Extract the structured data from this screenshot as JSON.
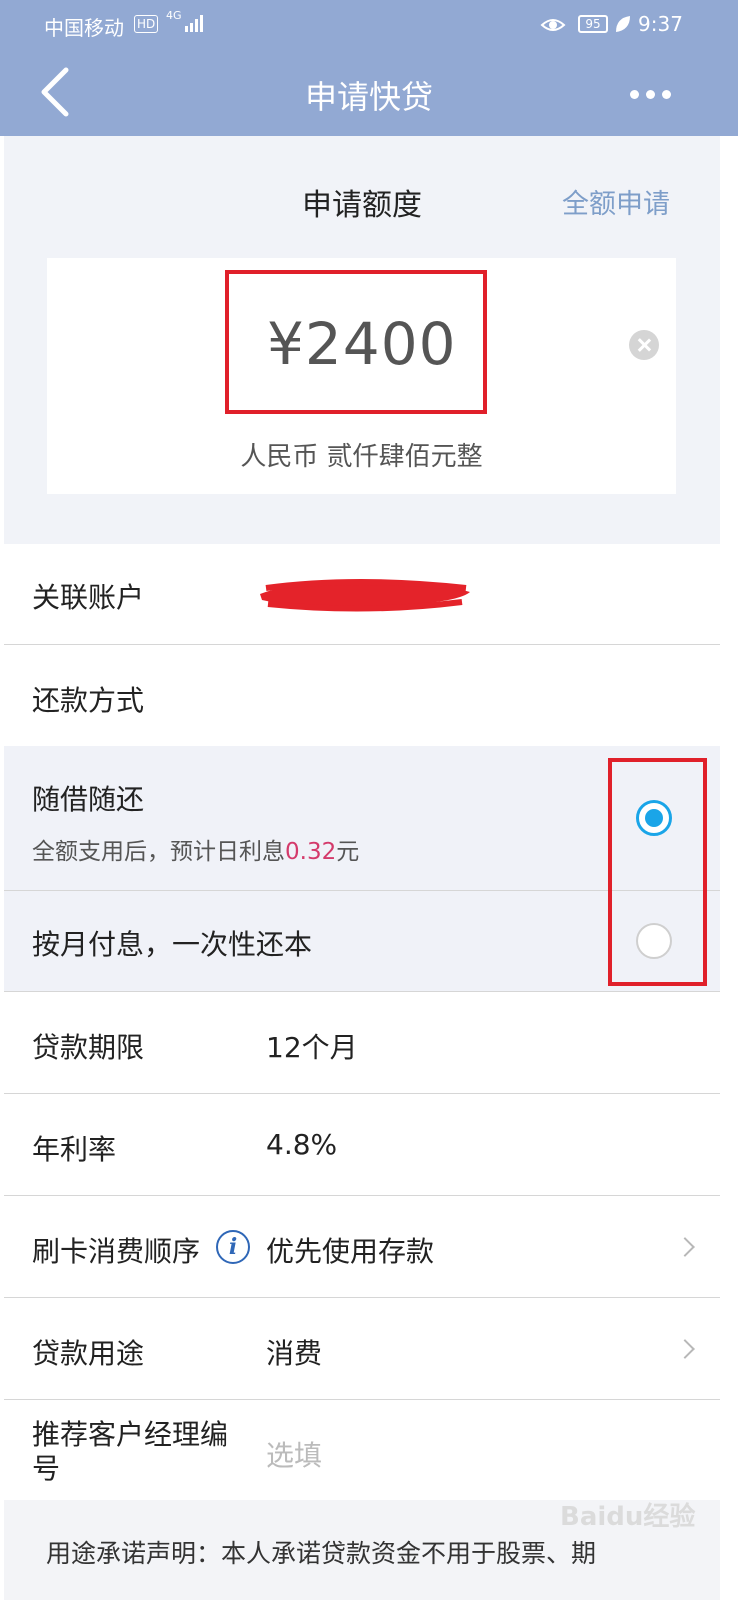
{
  "status_bar": {
    "carrier": "中国移动",
    "hd_badge": "HD",
    "network": "4G",
    "battery": "95",
    "time": "9:37"
  },
  "nav": {
    "title": "申请快贷",
    "back_icon": "chevron-left-icon",
    "more_icon": "more-dots-icon"
  },
  "amount": {
    "title": "申请额度",
    "full_apply": "全额申请",
    "value": "¥2400",
    "words": "人民币  贰仟肆佰元整"
  },
  "linked_account": {
    "label": "关联账户"
  },
  "repayment": {
    "label": "还款方式",
    "options": [
      {
        "label": "随借随还",
        "sub_prefix": "全额支用后，预计日利息",
        "sub_amount": "0.32",
        "sub_suffix": "元",
        "selected": true
      },
      {
        "label": "按月付息，一次性还本",
        "selected": false
      }
    ]
  },
  "term": {
    "label": "贷款期限",
    "value": "12个月"
  },
  "rate": {
    "label": "年利率",
    "value": "4.8%"
  },
  "card_order": {
    "label": "刷卡消费顺序",
    "value": "优先使用存款"
  },
  "purpose": {
    "label": "贷款用途",
    "value": "消费"
  },
  "manager": {
    "label_line1": "推荐客户经理编",
    "label_line2": "号",
    "placeholder": "选填"
  },
  "notice": {
    "text": "用途承诺声明：本人承诺贷款资金不用于股票、期"
  },
  "watermark": "Baidu经验",
  "colors": {
    "header_bg": "#92a9d3",
    "accent_link": "#7e9ec9",
    "radio_selected": "#1aa5e8",
    "highlight_box": "#e0202a",
    "interest_pink": "#d43a6b"
  }
}
